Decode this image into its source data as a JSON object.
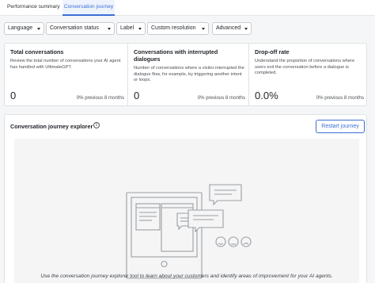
{
  "tabs": [
    {
      "label": "Performance summary",
      "active": false
    },
    {
      "label": "Conversation journey",
      "active": true
    }
  ],
  "filters": [
    {
      "label": "Language"
    },
    {
      "label": "Conversation status"
    },
    {
      "label": "Label"
    },
    {
      "label": "Custom resolution"
    },
    {
      "label": "Advanced"
    }
  ],
  "cards": [
    {
      "title": "Total conversations",
      "description": "Review the total number of conversations your AI agent has handled with UltimateGPT.",
      "value": "0",
      "previous": "0% previous 8 months"
    },
    {
      "title": "Conversations with interrupted dialogues",
      "description": "Number of conversations where a visitor interrupted the dialogue flow, for example, by triggering another intent or loops.",
      "value": "0",
      "previous": "0% previous 8 months"
    },
    {
      "title": "Drop-off rate",
      "description": "Understand the proportion of conversations where users exit the conversation before a dialogue is completed.",
      "value": "0.0%",
      "previous": "0% previous 8 months"
    }
  ],
  "explorer": {
    "title": "Conversation journey explorer",
    "info_icon": "info-icon",
    "restart_label": "Restart journey",
    "caption": "Use the conversation journey explorer tool to learn about your customers and identify areas of improvement for your AI agents."
  },
  "colors": {
    "accent": "#3a6fd6",
    "background": "#f5f6f7",
    "border": "#dfe1e4"
  }
}
